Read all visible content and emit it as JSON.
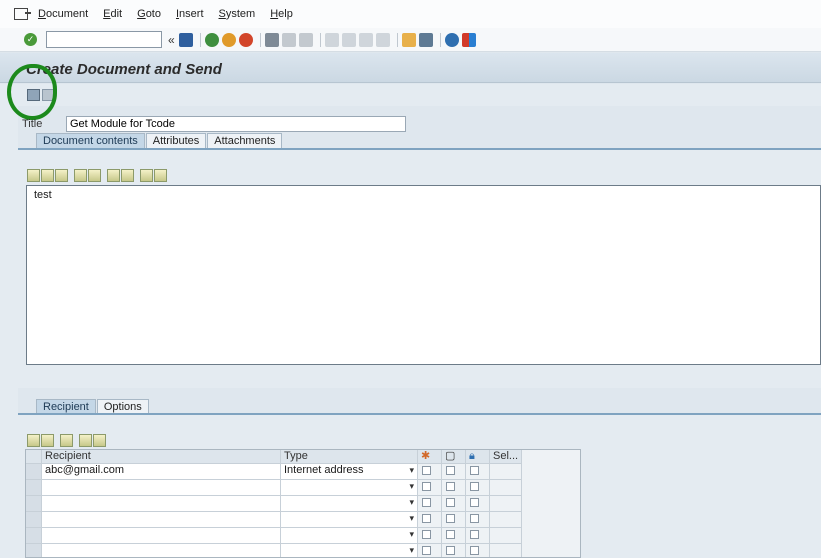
{
  "menu": {
    "items": [
      {
        "u": "D",
        "rest": "ocument"
      },
      {
        "u": "E",
        "rest": "dit"
      },
      {
        "u": "G",
        "rest": "oto"
      },
      {
        "u": "I",
        "rest": "nsert"
      },
      {
        "u": "S",
        "rest": "ystem"
      },
      {
        "u": "H",
        "rest": "elp"
      }
    ]
  },
  "toolbar": {
    "command_value": "",
    "collapse_glyph": "«"
  },
  "page": {
    "title": "Create Document and Send"
  },
  "form": {
    "title_label": "Title",
    "title_value": "Get Module for Tcode"
  },
  "content_tabs": [
    {
      "label": "Document contents",
      "active": true
    },
    {
      "label": "Attributes",
      "active": false
    },
    {
      "label": "Attachments",
      "active": false
    }
  ],
  "editor": {
    "text": "test"
  },
  "recipient_tabs": [
    {
      "label": "Recipient",
      "active": true
    },
    {
      "label": "Options",
      "active": false
    }
  ],
  "recipient_grid": {
    "columns": [
      "Recipient",
      "Type",
      "",
      "",
      "",
      "Sel..."
    ],
    "rows": [
      {
        "recipient": "abc@gmail.com",
        "type": "Internet address"
      },
      {
        "recipient": "",
        "type": ""
      },
      {
        "recipient": "",
        "type": ""
      },
      {
        "recipient": "",
        "type": ""
      },
      {
        "recipient": "",
        "type": ""
      },
      {
        "recipient": "",
        "type": ""
      }
    ]
  },
  "colors": {
    "highlight": "#1c8a1c",
    "tab_active": "#c4d7e7",
    "panel": "#e4ebf1"
  },
  "icons": [
    "app-menu-icon",
    "ok-icon",
    "save-icon",
    "back-icon",
    "exit-icon",
    "cancel-icon",
    "print-icon",
    "find-icon",
    "find-next-icon",
    "first-page-icon",
    "previous-page-icon",
    "next-page-icon",
    "last-page-icon",
    "new-session-icon",
    "shortcut-icon",
    "help-icon",
    "layout-icon",
    "send-icon",
    "lock-icon"
  ]
}
